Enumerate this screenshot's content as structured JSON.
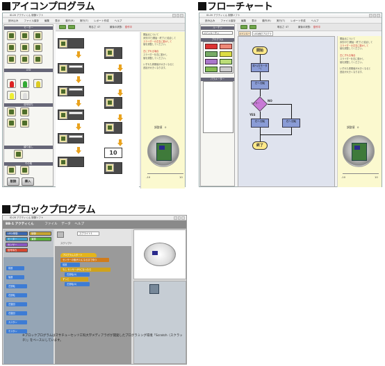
{
  "headings": {
    "icon": "アイコンプログラム",
    "flow": "フローチャート",
    "block": "ブロックプログラム"
  },
  "app": {
    "title": "ID-20 アクティくん 制御ソフト",
    "menu": [
      "読み込み",
      "ファイル保存",
      "編集",
      "表示",
      "動作(R)",
      "実行(T)",
      "レポート作成",
      "ヘルプ"
    ],
    "toolbar_label": "明るさ",
    "toolbar_value1": "47",
    "toolbar_label2": "最後の状態:",
    "toolbar_value2": "動作中"
  },
  "icon_panel": {
    "sections": [
      "モーター",
      "LED",
      "信号待ち",
      "繰り返し",
      "その他"
    ],
    "btn_delete": "削除",
    "btn_insert": "挿入",
    "value_box": "10"
  },
  "flow_panel": {
    "palette_title": "ルーチン",
    "palette_select": "メインルーチン",
    "program_label": "プログラム",
    "param_label": "パラメーター",
    "tabs": [
      "メインルーチン",
      "LED消灯プログラム"
    ],
    "start": "開始",
    "end": "終了",
    "box1": "前へ(左モーター)",
    "box2": "左へ 回転",
    "box3": "右へ 回転",
    "box4": "右へ 回転",
    "no": "NO",
    "yes": "YES",
    "ir_label": "センサー"
  },
  "notes": {
    "line1": "開始点について",
    "line2": "赤矢印で(開始・終了)と結合して",
    "line3": "他にずれる場合",
    "line4": "スライダーの左右に動かして",
    "line5": "値を調整してください。",
    "line6": "左にずれる場合",
    "line7": "スライダーを右に動かし",
    "line8": "値を調整してください。",
    "line9": "いずれも周期値が大きくなると",
    "line10": "遅延が大きくなります。"
  },
  "gauge": {
    "label": "調整値",
    "value": "0",
    "min": "-10",
    "max": "10"
  },
  "scratch": {
    "title": "BB-1 アクティくん",
    "menu": [
      "ファイル",
      "データ",
      "ヘルプ"
    ],
    "categories": [
      "LED/挙動",
      "モーター",
      "センサー",
      "信号待ち",
      "制御",
      "演算"
    ],
    "side_blocks": [
      "前進",
      "後退",
      "左回転",
      "右回転",
      "左旋回",
      "右旋回",
      "カスタン",
      "ホスタン"
    ],
    "sprite_name": "スプライト1",
    "tab_script": "スクリプト",
    "script": [
      "プログラムスタート",
      "センサーの値が(1)になるまで待つ",
      "前進",
      "もし センサーが0になったら",
      "右回転(4)",
      "ずっと",
      "左回転(4)"
    ],
    "caption": "※ブロックプログラムはマサチューセッツ工科大学メディアラボが開発したプログラミング環境「Scratch（スクラッチ）」をベースにしています。"
  },
  "colors": {
    "accent": "#6fa44a",
    "note": "#fbf9cf",
    "flow": "#8a9cd6",
    "terminator": "#ffea8a",
    "arrow": "#e9a21e"
  }
}
